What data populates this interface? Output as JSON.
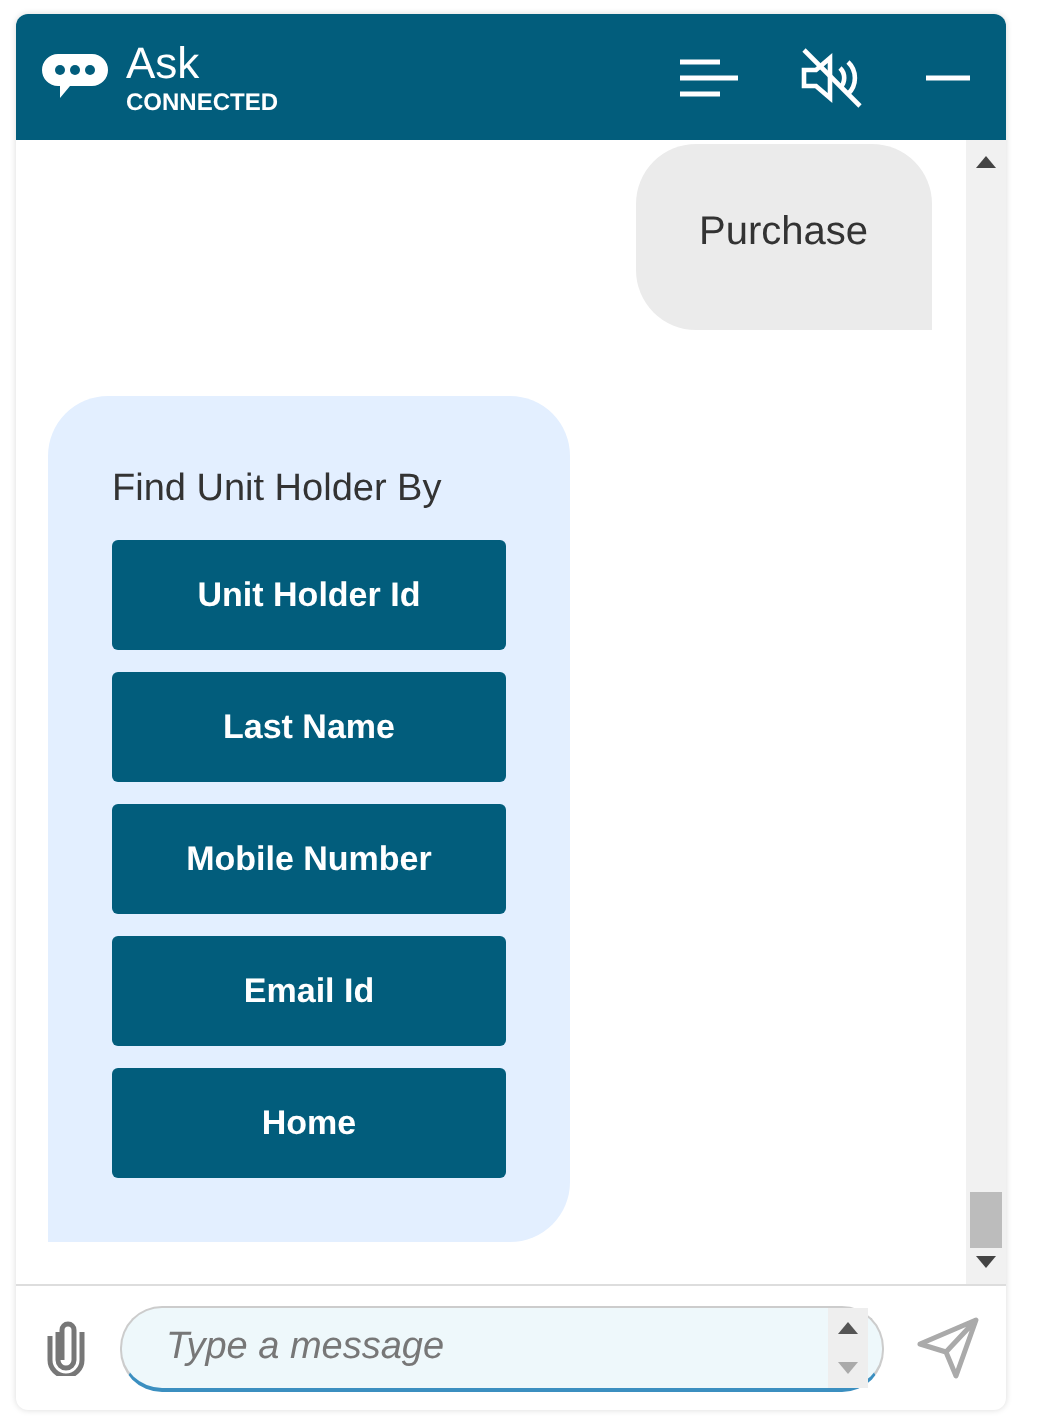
{
  "header": {
    "title": "Ask",
    "status": "CONNECTED"
  },
  "messages": [
    {
      "kind": "user",
      "text": "Purchase"
    },
    {
      "kind": "bot",
      "text": "Find Unit Holder By",
      "options": [
        "Unit Holder Id",
        "Last Name",
        "Mobile Number",
        "Email Id",
        "Home"
      ]
    }
  ],
  "composer": {
    "placeholder": "Type a message"
  }
}
